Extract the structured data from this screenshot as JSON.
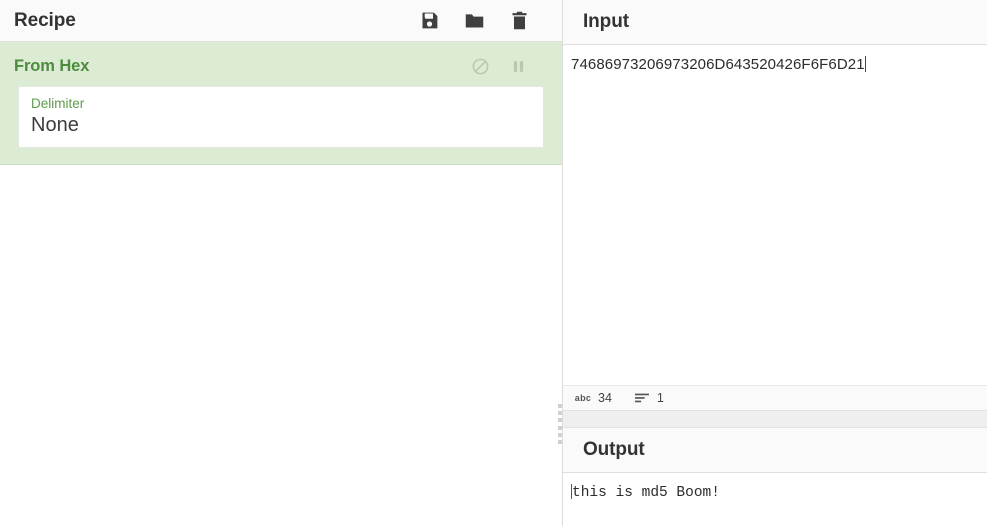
{
  "recipe": {
    "title": "Recipe",
    "toolbar_icons": [
      {
        "name": "save-icon",
        "label": "Save recipe"
      },
      {
        "name": "folder-icon",
        "label": "Load recipe"
      },
      {
        "name": "trash-icon",
        "label": "Clear recipe"
      }
    ],
    "operations": [
      {
        "title": "From Hex",
        "control_icons": [
          {
            "name": "disable-icon",
            "label": "Disable operation"
          },
          {
            "name": "pause-icon",
            "label": "Set breakpoint"
          }
        ],
        "ingredients": [
          {
            "label": "Delimiter",
            "value": "None"
          }
        ]
      }
    ]
  },
  "input": {
    "title": "Input",
    "value": "74686973206973206D643520426F6F6D21",
    "status": {
      "length_icon": "abc",
      "length_label": "abc",
      "length": "34",
      "lines_icon": "lines-icon",
      "lines": "1"
    }
  },
  "output": {
    "title": "Output",
    "value": "this is md5 Boom!"
  },
  "colors": {
    "operation_background": "#dcecd4",
    "operation_title": "#4d8b3f",
    "ingredient_label": "#5d9c4d",
    "titlebar_background": "#fafafa",
    "icon_dark": "#3f3f3f",
    "icon_muted": "#b9c9b0"
  }
}
